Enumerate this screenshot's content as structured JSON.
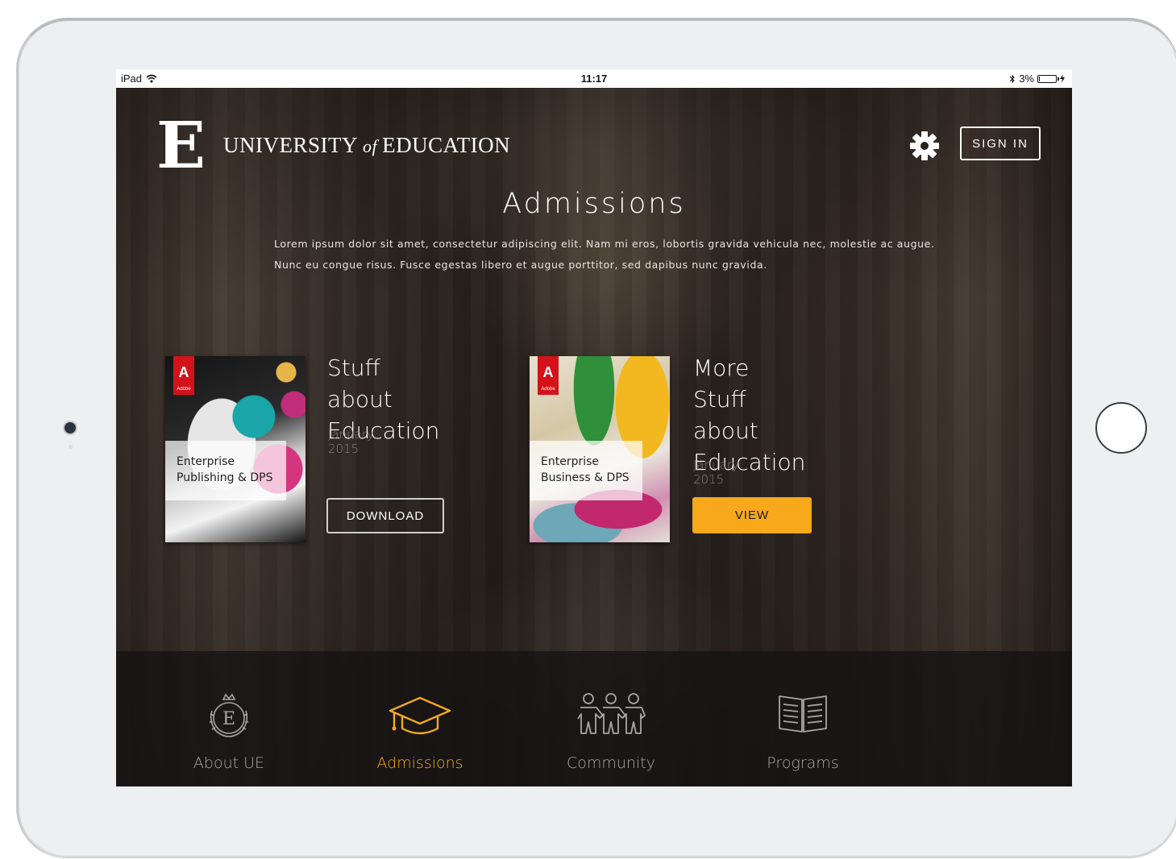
{
  "status_bar": {
    "carrier": "iPad",
    "time": "11:17",
    "battery": "3%",
    "battery_level_percent": 3,
    "icons": [
      "wifi-icon",
      "bluetooth-icon",
      "battery-icon",
      "charging-icon"
    ]
  },
  "header": {
    "logo_letter": "E",
    "brand_left": "UNIVERSITY",
    "brand_of": "of",
    "brand_right": "EDUCATION",
    "settings_icon": "gear-icon",
    "signin_label": "SIGN IN"
  },
  "main": {
    "title": "Admissions",
    "intro_line1": "Lorem ipsum dolor sit amet, consectetur adipiscing elit. Nam mi eros, lobortis gravida vehicula nec, molestie ac augue.",
    "intro_line2": "Nunc eu congue risus. Fusce egestas libero et augue porttitor, sed dapibus nunc gravida.",
    "cards": [
      {
        "cover_brand": "Adobe",
        "cover_label_line1": "Enterprise",
        "cover_label_line2": "Publishing & DPS",
        "title_line1": "Stuff about",
        "title_line2": "Education",
        "date": "January 2015",
        "button_label": "DOWNLOAD"
      },
      {
        "cover_brand": "Adobe",
        "cover_label_line1": "Enterprise",
        "cover_label_line2": "Business & DPS",
        "title_line1": "More Stuff",
        "title_line2": "about",
        "title_line3": "Education",
        "date": "January 2015",
        "button_label": "VIEW"
      }
    ]
  },
  "tabbar": {
    "tabs": [
      {
        "label": "About UE",
        "icon": "crest-icon",
        "active": false
      },
      {
        "label": "Admissions",
        "icon": "graduation-cap-icon",
        "active": true
      },
      {
        "label": "Community",
        "icon": "people-icon",
        "active": false
      },
      {
        "label": "Programs",
        "icon": "open-book-icon",
        "active": false
      }
    ]
  },
  "colors": {
    "accent": "#f7a81b",
    "text_primary": "#ffffff",
    "text_muted": "#a7a7a7",
    "adobe_red": "#d4121a"
  }
}
